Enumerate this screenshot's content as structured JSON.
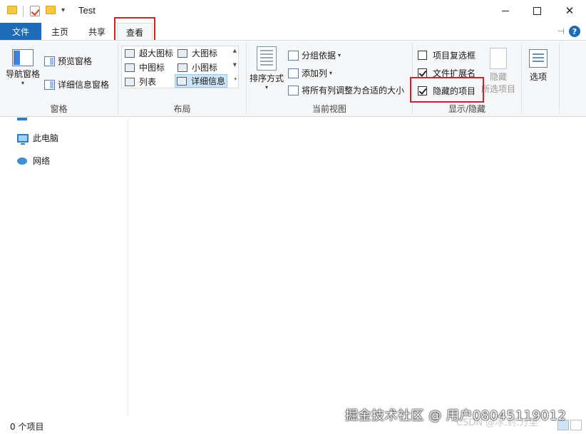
{
  "titlebar": {
    "title": "Test",
    "quick_access_dropdown": "▾",
    "controls": {
      "close": "✕"
    }
  },
  "tabs": {
    "file": "文件",
    "home": "主页",
    "share": "共享",
    "view": "查看"
  },
  "ribbon": {
    "panes": {
      "label": "窗格",
      "nav_pane": "导航窗格",
      "preview_pane": "预览窗格",
      "details_pane": "详细信息窗格"
    },
    "layout": {
      "label": "布局",
      "items": [
        "超大图标",
        "大图标",
        "中图标",
        "小图标",
        "列表",
        "详细信息"
      ],
      "selected": "详细信息"
    },
    "current_view": {
      "label": "当前视图",
      "sort_by": "排序方式",
      "group_by": "分组依据",
      "add_columns": "添加列",
      "size_all_columns": "将所有列调整为合适的大小"
    },
    "show_hide": {
      "label": "显示/隐藏",
      "item_checkboxes": {
        "text": "项目复选框",
        "checked": false
      },
      "file_extensions": {
        "text": "文件扩展名",
        "checked": true
      },
      "hidden_items": {
        "text": "隐藏的项目",
        "checked": true
      },
      "hide_selected_line1": "隐藏",
      "hide_selected_line2": "所选项目"
    },
    "options": "选项"
  },
  "nav_pane": {
    "items": [
      "此电脑",
      "网络"
    ]
  },
  "status": {
    "item_count": "0 个项目"
  },
  "watermark": {
    "text": "掘金技术社区 @ 用户08045119012",
    "text2": "CSDN @冰.封.万里"
  },
  "colors": {
    "file_tab": "#1e6cb8",
    "highlight_box": "#d41f26",
    "selected_layout": "#cce4f7"
  }
}
